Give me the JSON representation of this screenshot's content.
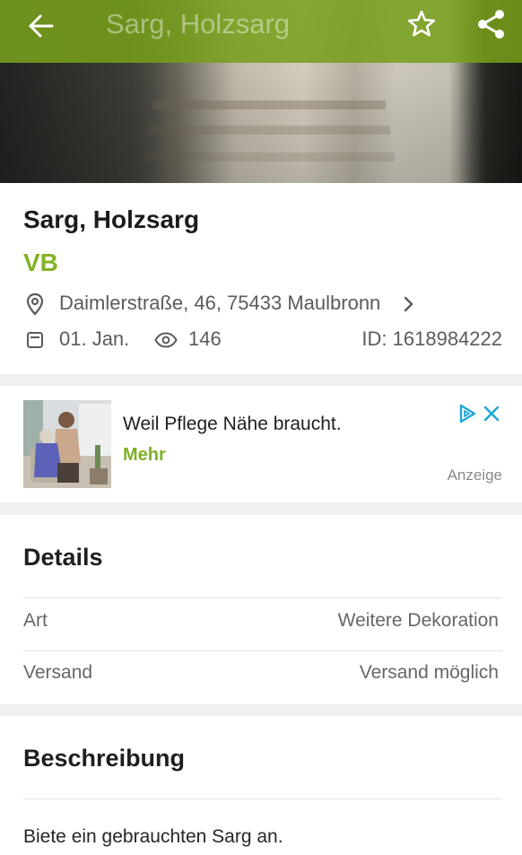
{
  "toolbar": {
    "title": "Sarg, Holzsarg",
    "icons": {
      "back": "arrow-left-icon",
      "favorite": "star-outline-icon",
      "share": "share-icon"
    },
    "background_color": "#769e1a"
  },
  "listing": {
    "title": "Sarg, Holzsarg",
    "price": "VB",
    "price_color": "#84b226",
    "address": "Daimlerstraße, 46, 75433 Maulbronn",
    "date": "01. Jan.",
    "views": "146",
    "id": "ID: 1618984222"
  },
  "ad": {
    "headline": "Weil Pflege Nähe braucht.",
    "cta": "Mehr",
    "label": "Anzeige"
  },
  "details": {
    "title": "Details",
    "rows": [
      {
        "key": "Art",
        "value": "Weitere Dekoration"
      },
      {
        "key": "Versand",
        "value": "Versand möglich"
      }
    ]
  },
  "description": {
    "title": "Beschreibung",
    "text": "Biete ein gebrauchten Sarg an."
  }
}
